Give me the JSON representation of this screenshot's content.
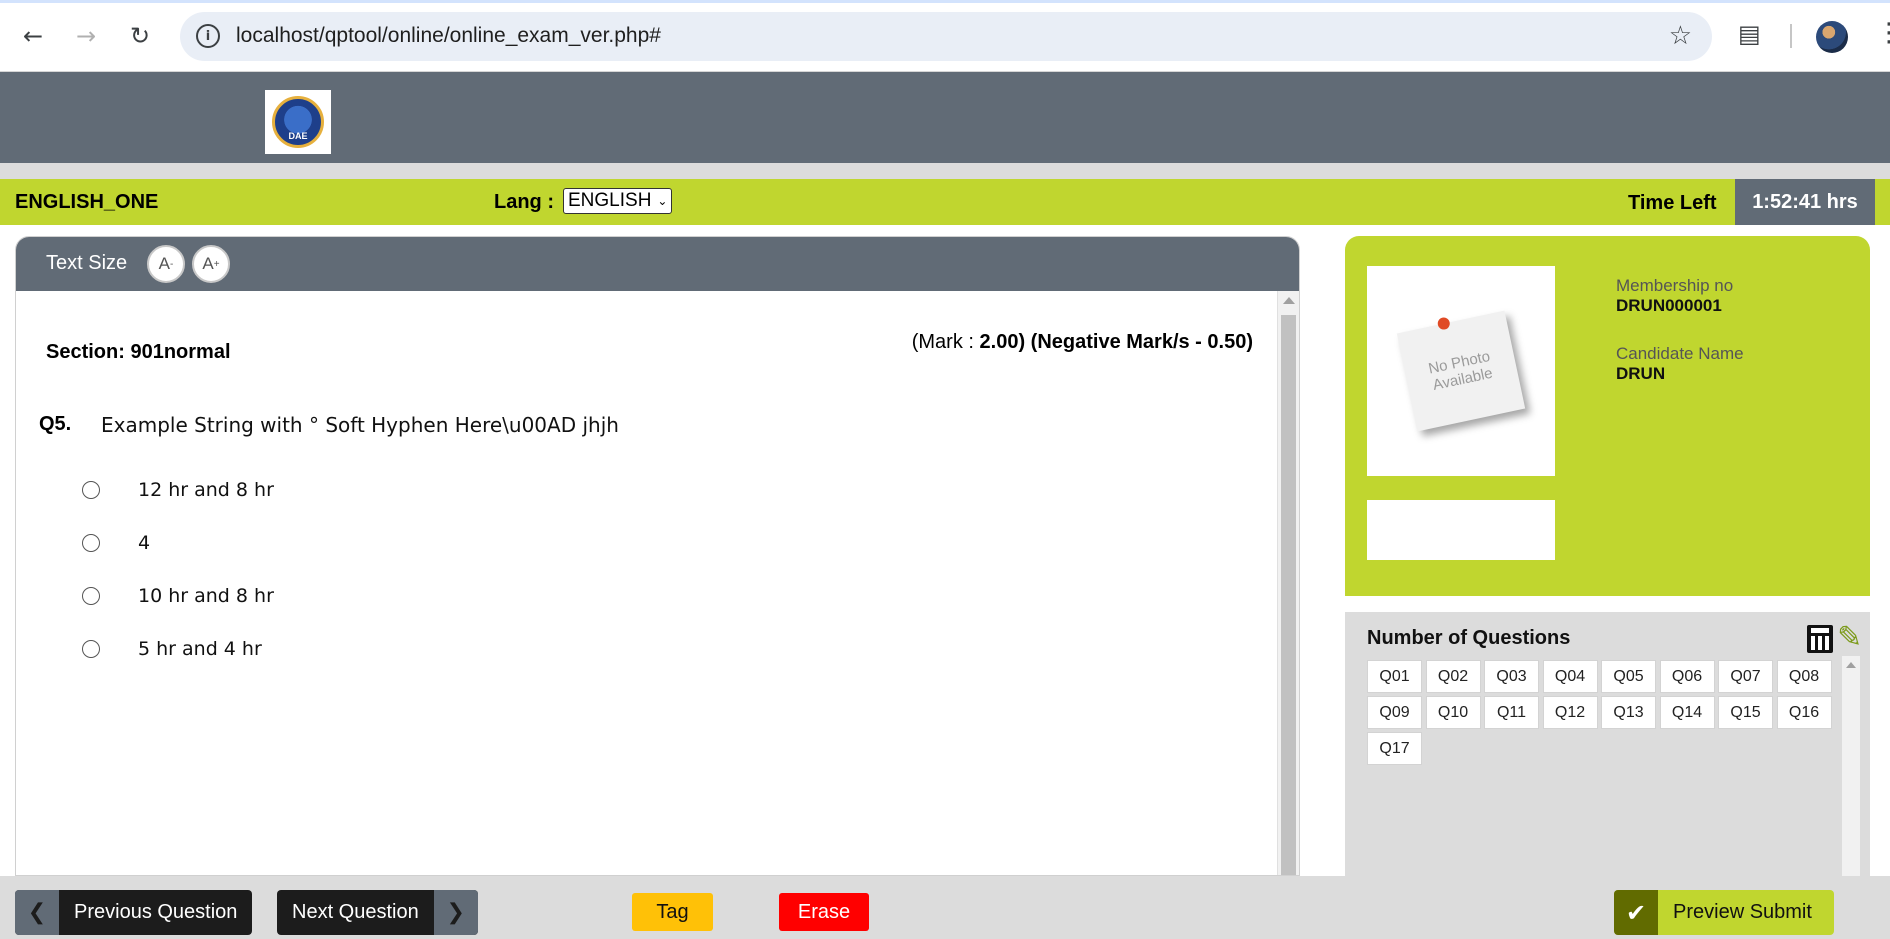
{
  "browser": {
    "url": "localhost/qptool/online/online_exam_ver.php#",
    "icons": [
      "back-icon",
      "forward-icon",
      "reload-icon",
      "info-icon",
      "star-icon",
      "extensions-icon",
      "profile-avatar",
      "more-menu-icon"
    ]
  },
  "header": {
    "logo_text": "DAE"
  },
  "exam_bar": {
    "exam_name": "ENGLISH_ONE",
    "lang_label": "Lang :",
    "lang_selected": "ENGLISH",
    "time_label": "Time Left",
    "time_value": "1:52:41 hrs"
  },
  "question_panel": {
    "text_size_label": "Text Size",
    "decrease_label": "A",
    "decrease_sup": "-",
    "increase_label": "A",
    "increase_sup": "+",
    "section": "Section: 901normal",
    "mark_prefix": "(Mark : ",
    "mark_value": "2.00)",
    "negative_mark": "(Negative Mark/s - 0.50)",
    "question_number": "Q5.",
    "question_text": "Example  String with ° Soft Hyphen Here\\u00AD jhjh",
    "options": [
      "12 hr and 8 hr",
      "4",
      "10 hr and 8 hr",
      "5 hr and 4 hr"
    ]
  },
  "candidate": {
    "photo_text": "No Photo Available",
    "membership_label": "Membership no",
    "membership_value": "DRUN000001",
    "name_label": "Candidate Name",
    "name_value": "DRUN"
  },
  "palette": {
    "title": "Number of Questions",
    "questions": [
      "Q01",
      "Q02",
      "Q03",
      "Q04",
      "Q05",
      "Q06",
      "Q07",
      "Q08",
      "Q09",
      "Q10",
      "Q11",
      "Q12",
      "Q13",
      "Q14",
      "Q15",
      "Q16",
      "Q17"
    ]
  },
  "footer": {
    "previous_label": "Previous Question",
    "next_label": "Next Question",
    "tag_label": "Tag",
    "erase_label": "Erase",
    "submit_label": "Preview Submit"
  },
  "colors": {
    "accent_green": "#c0d62f",
    "header_gray": "#616b76",
    "tag_yellow": "#ffc107",
    "erase_red": "#ff0000"
  }
}
